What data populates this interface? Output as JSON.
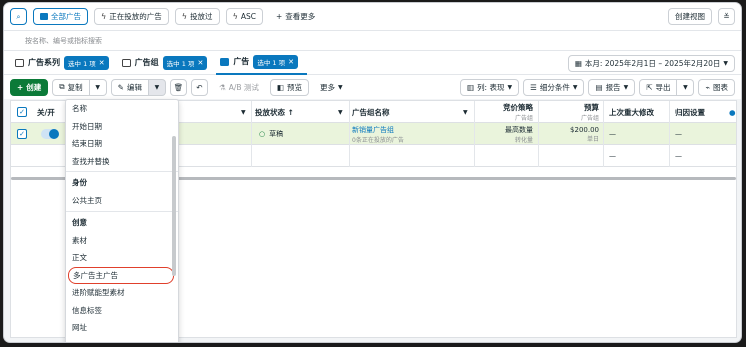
{
  "filterbar": {
    "search_icon": "search-icon",
    "all_ads": "全部广告",
    "active_ads": "正在投放的广告",
    "delivered": "投放过",
    "asc": "ASC",
    "more": "查看更多",
    "create_view": "创建视图"
  },
  "search": {
    "placeholder": "按名称、编号或指标搜索"
  },
  "levels": {
    "campaigns": {
      "label": "广告系列",
      "chip": "选中 1 项"
    },
    "adsets": {
      "label": "广告组",
      "chip": "选中 1 项"
    },
    "ads": {
      "label": "广告",
      "chip": "选中 1 项"
    },
    "date": "本月: 2025年2月1日 – 2025年2月20日"
  },
  "toolbar": {
    "create": "创建",
    "duplicate": "复制",
    "edit": "编辑",
    "ab_test": "A/B 测试",
    "preview": "预览",
    "more": "更多",
    "columns": "列: 表现",
    "breakdown": "细分条件",
    "reports": "报告",
    "export": "导出",
    "charts": "图表"
  },
  "table": {
    "headers": {
      "onoff": "关/开",
      "delivery": "投放状态 ↑",
      "adset_name": "广告组名称",
      "bid": "竞价策略",
      "bid_sub": "广告组",
      "budget": "预算",
      "budget_sub": "广告组",
      "last_edit": "上次重大修改",
      "attribution": "归因设置"
    },
    "row1": {
      "delivery": "草稿",
      "adset_name": "新销量广告组",
      "adset_sub": "0条正在投放的广告",
      "bid": "最高数量",
      "bid_sub": "转化量",
      "budget": "$200.00",
      "budget_sub": "单日",
      "last_edit": "—",
      "attribution": "—"
    },
    "row2": {
      "last_edit": "—",
      "attribution": "—"
    }
  },
  "menu": {
    "items1": [
      "名称",
      "开始日期",
      "结束日期",
      "查找并替换"
    ],
    "section_identity": "身份",
    "items2": [
      "公共主页"
    ],
    "section_creative": "创意",
    "items3": [
      "素材",
      "正文",
      "多广告主广告",
      "进阶赋能型素材",
      "信息标签",
      "网址"
    ]
  },
  "colors": {
    "accent": "#0a78be",
    "create_green": "#0b7a38",
    "highlight": "#e0402c",
    "row_selected": "#eaf4dc"
  }
}
